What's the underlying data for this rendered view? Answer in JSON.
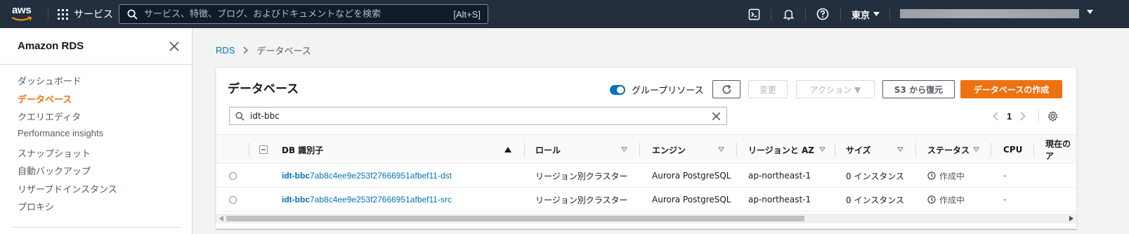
{
  "topnav": {
    "logo_text": "aws",
    "services_label": "サービス",
    "search_placeholder": "サービス、特徴、ブログ、およびドキュメントなどを検索",
    "search_shortcut": "[Alt+S]",
    "region_label": "東京",
    "icons": [
      "cloudshell-icon",
      "bell-icon",
      "help-icon"
    ]
  },
  "sidebar": {
    "title": "Amazon RDS",
    "items": [
      {
        "label": "ダッシュボード",
        "active": false
      },
      {
        "label": "データベース",
        "active": true
      },
      {
        "label": "クエリエディタ",
        "active": false
      },
      {
        "label": "Performance insights",
        "active": false
      },
      {
        "label": "スナップショット",
        "active": false
      },
      {
        "label": "自動バックアップ",
        "active": false
      },
      {
        "label": "リザーブドインスタンス",
        "active": false
      },
      {
        "label": "プロキシ",
        "active": false
      }
    ]
  },
  "breadcrumb": {
    "root": "RDS",
    "current": "データベース"
  },
  "panel": {
    "title": "データベース",
    "group_resources_label": "グループリソース",
    "group_resources_on": true,
    "buttons": {
      "modify": "変更",
      "actions": "アクション ▼",
      "restore_s3": "S3 から復元",
      "create": "データベースの作成"
    },
    "filter_value": "idt-bbc",
    "page": "1"
  },
  "table": {
    "columns": [
      "DB 識別子",
      "ロール",
      "エンジン",
      "リージョンと AZ",
      "サイズ",
      "ステータス",
      "CPU",
      "現在のア"
    ],
    "rows": [
      {
        "id_match": "idt-bbc",
        "id_rest": "7ab8c4ee9e253f27666951afbef11-dst",
        "role": "リージョン別クラスター",
        "engine": "Aurora PostgreSQL",
        "region": "ap-northeast-1",
        "size": "0 インスタンス",
        "status": "作成中",
        "cpu": "-"
      },
      {
        "id_match": "idt-bbc",
        "id_rest": "7ab8c4ee9e253f27666951afbef11-src",
        "role": "リージョン別クラスター",
        "engine": "Aurora PostgreSQL",
        "region": "ap-northeast-1",
        "size": "0 インスタンス",
        "status": "作成中",
        "cpu": "-"
      }
    ]
  },
  "colors": {
    "nav_bg": "#232f3e",
    "accent": "#ec7211",
    "link": "#0073bb"
  }
}
